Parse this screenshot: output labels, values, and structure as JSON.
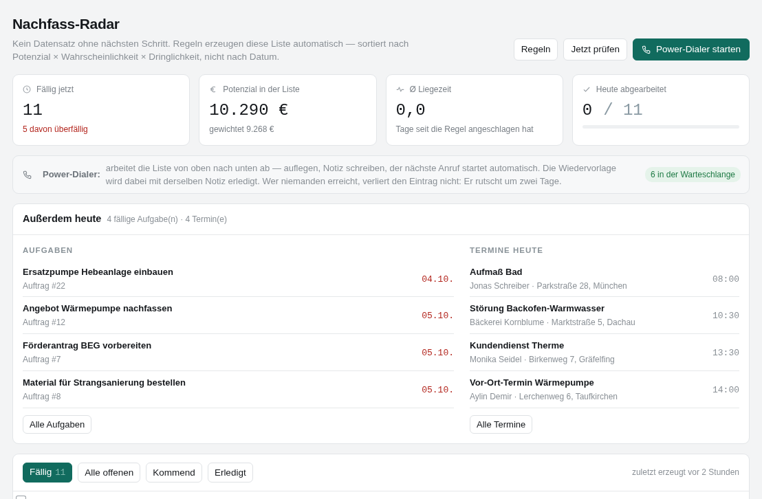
{
  "header": {
    "title": "Nachfass-Radar",
    "subtitle": "Kein Datensatz ohne nächsten Schritt. Regeln erzeugen diese Liste automatisch — sortiert nach Potenzial × Wahrscheinlichkeit × Dringlichkeit, nicht nach Datum.",
    "buttons": [
      {
        "label": "Regeln",
        "kind": "outline"
      },
      {
        "label": "Jetzt prüfen",
        "kind": "outline"
      },
      {
        "label": "Power-Dialer starten",
        "kind": "primary"
      }
    ]
  },
  "stats": [
    {
      "kind": "due",
      "label": "Fällig jetzt",
      "value": "11",
      "note": "5 davon überfällig",
      "alert": true
    },
    {
      "kind": "potential",
      "label": "Potenzial in der Liste",
      "value": "10.290 €",
      "note": "gewichtet 9.268 €",
      "alert": false
    },
    {
      "kind": "age",
      "label": "Ø Liegezeit",
      "value": "0,0",
      "note": "Tage seit die Regel angeschlagen hat",
      "alert": false
    },
    {
      "kind": "progress",
      "label": "Heute abgearbeitet",
      "value": "0",
      "total": "/ 11",
      "level": 0
    }
  ],
  "dialer": {
    "label": "Power-Dialer:",
    "text": "arbeitet die Liste von oben nach unten ab — auflegen, Notiz schreiben, der nächste Anruf startet automatisch. Die Wiedervorlage wird dabei mit derselben Notiz erledigt. Wer niemanden erreicht, verliert den Eintrag nicht: Er rutscht um zwei Tage.",
    "queue": "6 in der Warteschlange"
  },
  "today": {
    "title": "Außerdem heute",
    "meta": "4 fällige Aufgabe(n) · 4 Termin(e)",
    "columns": [
      {
        "kind": "tasks",
        "heading": "AUFGABEN",
        "items": [
          {
            "title": "Ersatzpumpe Hebeanlage einbauen",
            "sub": "Auftrag #22",
            "when": "04.10."
          },
          {
            "title": "Angebot Wärmepumpe nachfassen",
            "sub": "Auftrag #12",
            "when": "05.10."
          },
          {
            "title": "Förderantrag BEG vorbereiten",
            "sub": "Auftrag #7",
            "when": "05.10."
          },
          {
            "title": "Material für Strangsanierung bestellen",
            "sub": "Auftrag #8",
            "when": "05.10."
          }
        ],
        "button": "Alle Aufgaben"
      },
      {
        "kind": "appointments",
        "heading": "TERMINE HEUTE",
        "items": [
          {
            "title": "Aufmaß Bad",
            "sub": "Jonas Schreiber · Parkstraße 28, München",
            "when": "08:00"
          },
          {
            "title": "Störung Backofen-Warmwasser",
            "sub": "Bäckerei Kornblume · Marktstraße 5, Dachau",
            "when": "10:30"
          },
          {
            "title": "Kundendienst Therme",
            "sub": "Monika Seidel · Birkenweg 7, Gräfelfing",
            "when": "13:30"
          },
          {
            "title": "Vor-Ort-Termin Wärmepumpe",
            "sub": "Aylin Demir · Lerchenweg 6, Taufkirchen",
            "when": "14:00"
          }
        ],
        "button": "Alle Termine"
      }
    ]
  },
  "queue": {
    "tabs": [
      {
        "label": "Fällig",
        "count": "11",
        "selected": true
      },
      {
        "label": "Alle offenen",
        "selected": false
      },
      {
        "label": "Kommend",
        "selected": false
      },
      {
        "label": "Erledigt",
        "selected": false
      }
    ],
    "generated": "zuletzt erzeugt vor 2 Stunden",
    "select_all": {
      "checked": false
    }
  }
}
